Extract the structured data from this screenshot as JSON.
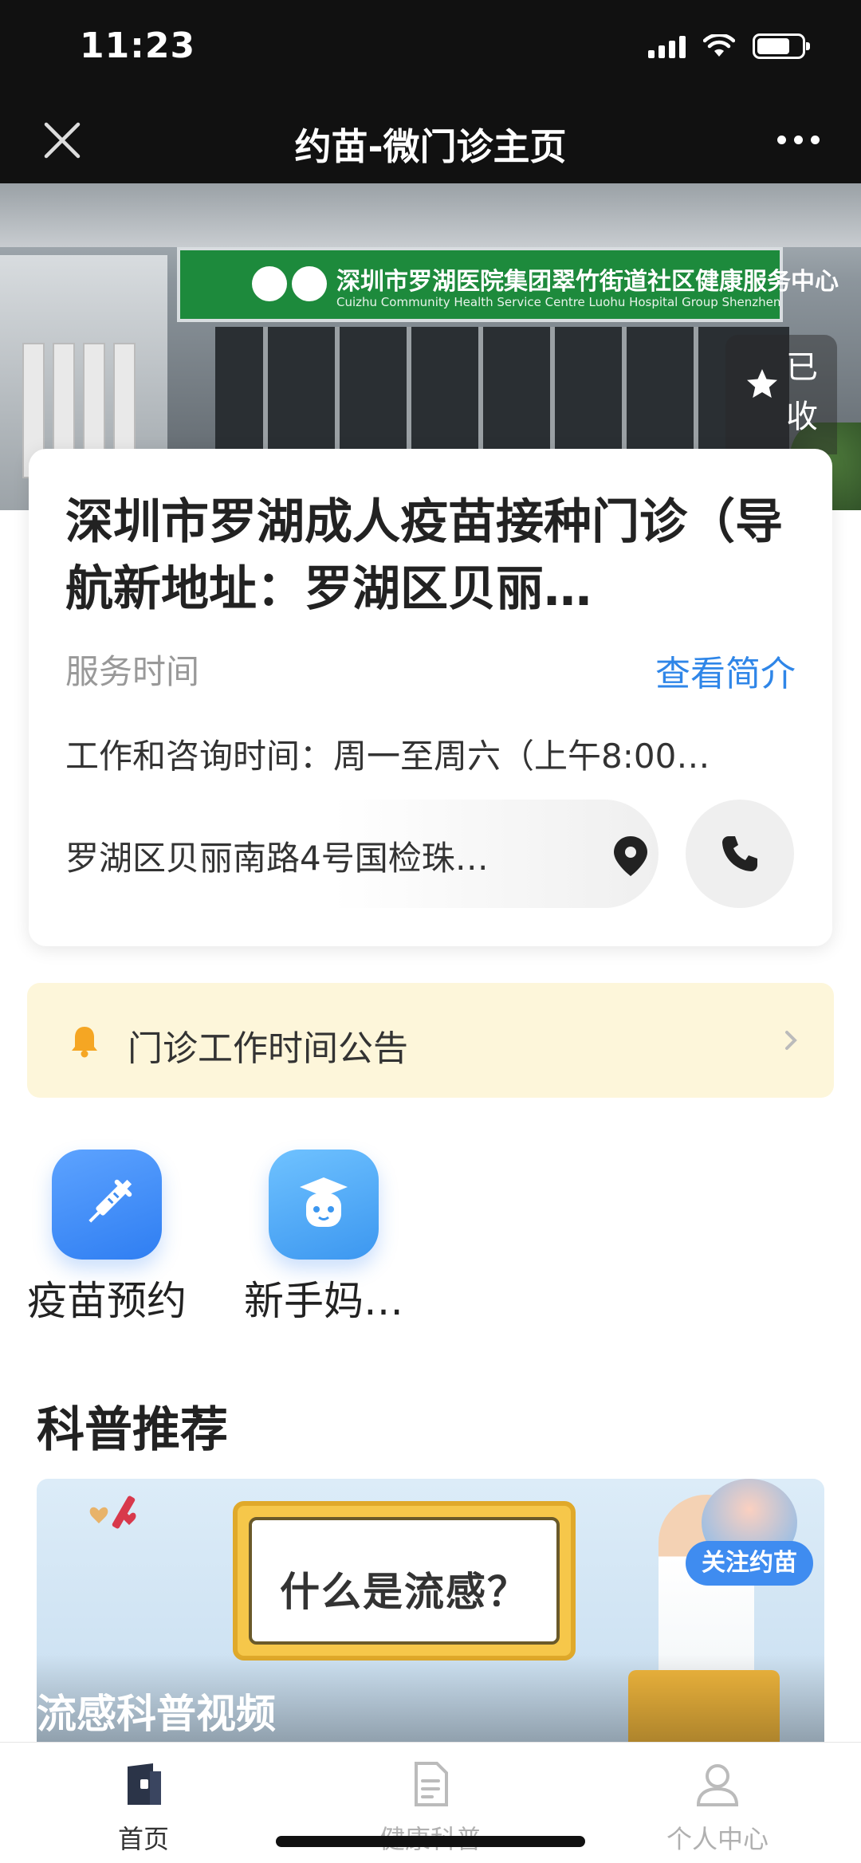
{
  "status_bar": {
    "time": "11:23"
  },
  "nav": {
    "title": "约苗-微门诊主页",
    "close_icon": "close-icon",
    "more_icon": "more-icon"
  },
  "hero": {
    "sign_cn": "深圳市罗湖医院集团翠竹街道社区健康服务中心",
    "sign_en": "Cuizhu Community Health Service Centre Luohu Hospital Group Shenzhen",
    "favorite_label": "已收藏"
  },
  "clinic": {
    "name": "深圳市罗湖成人疫苗接种门诊（导航新地址：罗湖区贝丽…",
    "service_label": "服务时间",
    "intro_link": "查看简介",
    "hours": "工作和咨询时间：周一至周六（上午8:00…",
    "address": "罗湖区贝丽南路4号国检珠…"
  },
  "notice": {
    "text": "门诊工作时间公告"
  },
  "quick_entries": [
    {
      "label": "疫苗预约",
      "icon": "syringe-icon"
    },
    {
      "label": "新手妈…",
      "icon": "graduate-baby-icon"
    }
  ],
  "science": {
    "section_title": "科普推荐",
    "banner_board": "什么是流感？",
    "banner_badge": "关注约苗",
    "banner_title": "流感科普视频"
  },
  "tabs": [
    {
      "label": "首页",
      "active": true
    },
    {
      "label": "健康科普",
      "active": false
    },
    {
      "label": "个人中心",
      "active": false
    }
  ],
  "colors": {
    "accent": "#2f86e8",
    "notice_bg": "#fdf6da",
    "bell": "#f5a623",
    "nav_bg": "#111111"
  }
}
